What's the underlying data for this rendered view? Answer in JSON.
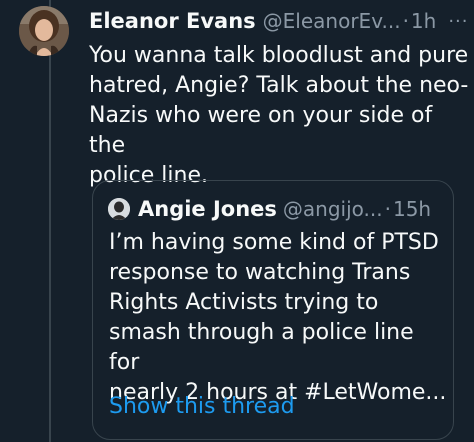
{
  "tweet": {
    "display_name": "Eleanor Evans",
    "handle": "@EleanorEv...",
    "separator": "·",
    "time": "1h",
    "more_icon": "more-horizontal-icon",
    "more_label": "···",
    "text": "You wanna talk bloodlust and pure\nhatred, Angie? Talk about the neo-\nNazis who were on your side of the\npolice line."
  },
  "quote": {
    "display_name": "Angie Jones",
    "handle": "@angijo...",
    "separator": "·",
    "time": "15h",
    "text": "I’m having some kind of PTSD\nresponse to watching Trans\nRights Activists trying to\nsmash through a police line for\nnearly 2 hours at #LetWome...",
    "show_thread_label": "Show this thread"
  },
  "colors": {
    "background": "#15202b",
    "text_primary": "#f7f9f9",
    "text_secondary": "#8b98a5",
    "border": "#38444d",
    "link": "#1d9bf0"
  }
}
